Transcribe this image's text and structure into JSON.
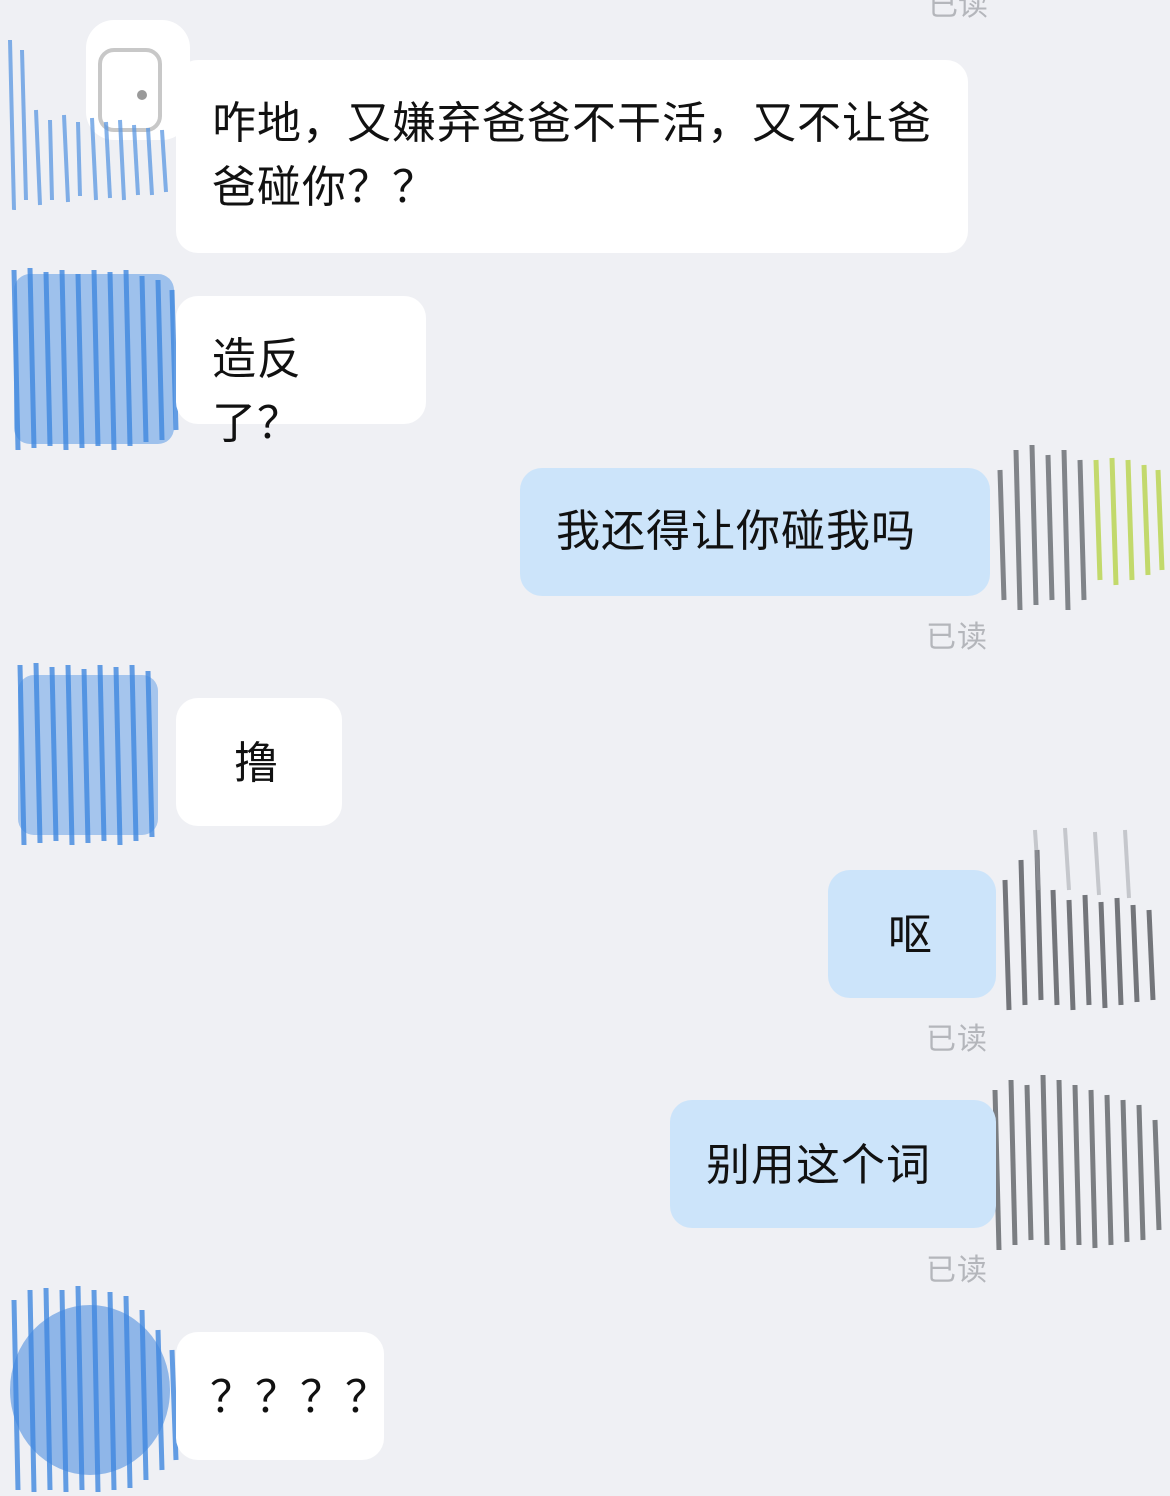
{
  "messages": [
    {
      "side": "incoming",
      "text": "咋地，又嫌弃爸爸不干活，又不让爸爸碰你？？"
    },
    {
      "side": "incoming",
      "text": "造反了？"
    },
    {
      "side": "outgoing",
      "text": "我还得让你碰我吗",
      "status": "已读"
    },
    {
      "side": "incoming",
      "text": "撸"
    },
    {
      "side": "outgoing",
      "text": "呕",
      "status": "已读"
    },
    {
      "side": "outgoing",
      "text": "别用这个词",
      "status": "已读"
    },
    {
      "side": "incoming",
      "text": "？？？？"
    }
  ],
  "top_status": "已读",
  "colors": {
    "background": "#eff0f4",
    "incoming_bubble": "#ffffff",
    "outgoing_bubble": "#cce4fa",
    "read_text": "#b4b6bb",
    "incoming_avatar": "#4a8fe0",
    "outgoing_avatar": "#5c6066",
    "outgoing_avatar_accent": "#b8d44a"
  }
}
